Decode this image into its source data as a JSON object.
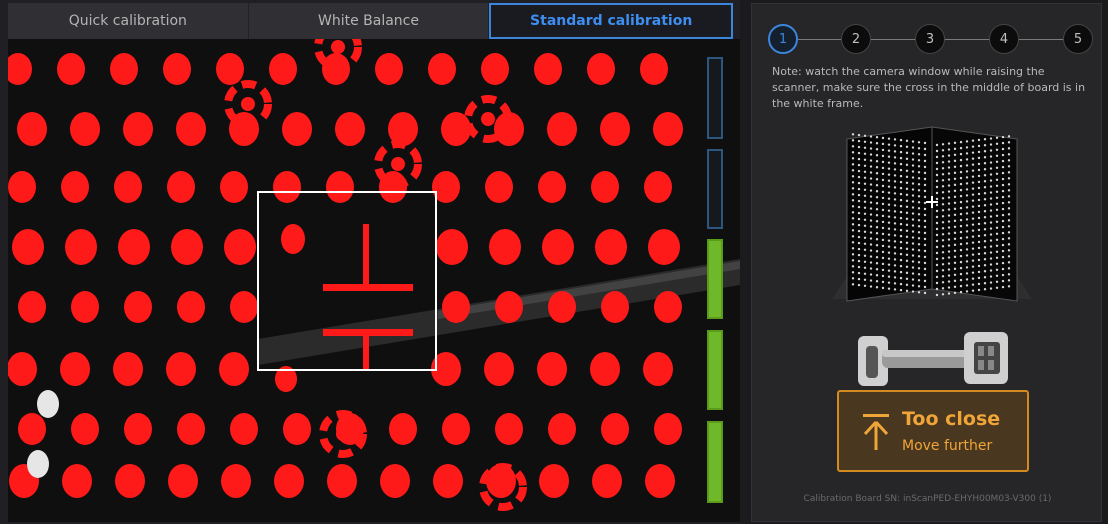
{
  "tabs": [
    {
      "label": "Quick calibration",
      "active": false
    },
    {
      "label": "White Balance",
      "active": false
    },
    {
      "label": "Standard calibration",
      "active": true
    }
  ],
  "distance_meter": {
    "segments": [
      {
        "state": "empty"
      },
      {
        "state": "empty"
      },
      {
        "state": "filled"
      },
      {
        "state": "filled"
      },
      {
        "state": "filled"
      }
    ],
    "colors": {
      "filled": "#6eb82a",
      "empty_border": "#2c5680"
    }
  },
  "camera_view": {
    "dot_color": "#ff1a1a",
    "frame_color": "#ffffff"
  },
  "steps": [
    {
      "label": "1",
      "active": true
    },
    {
      "label": "2",
      "active": false
    },
    {
      "label": "3",
      "active": false
    },
    {
      "label": "4",
      "active": false
    },
    {
      "label": "5",
      "active": false
    }
  ],
  "note": "Note: watch the camera window while raising the scanner, make sure the cross in the middle of board is in the white frame.",
  "warning": {
    "icon": "arrow-up-icon",
    "title": "Too close",
    "subtitle": "Move further",
    "color": "#f0a538"
  },
  "serial": "Calibration Board SN: inScanPED-EHYH00M03-V300 (1)",
  "accent": "#3b86dc"
}
